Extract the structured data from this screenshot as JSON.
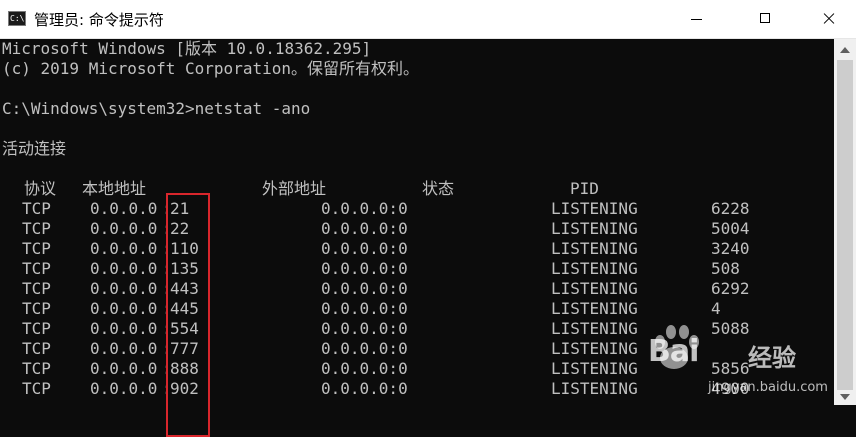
{
  "window": {
    "title": "管理员: 命令提示符",
    "icon_label": "C:\\"
  },
  "console": {
    "banner_line1": "Microsoft Windows [版本 10.0.18362.295]",
    "banner_line2": "(c) 2019 Microsoft Corporation。保留所有权利。",
    "prompt": "C:\\Windows\\system32>netstat -ano",
    "section_title": "活动连接",
    "headers": [
      "协议",
      "本地地址",
      "外部地址",
      "状态",
      "PID"
    ],
    "rows": [
      {
        "proto": "TCP",
        "local_ip": "0.0.0.0",
        "local_port": "21",
        "foreign": "0.0.0.0:0",
        "state": "LISTENING",
        "pid": "6228"
      },
      {
        "proto": "TCP",
        "local_ip": "0.0.0.0",
        "local_port": "22",
        "foreign": "0.0.0.0:0",
        "state": "LISTENING",
        "pid": "5004"
      },
      {
        "proto": "TCP",
        "local_ip": "0.0.0.0",
        "local_port": "110",
        "foreign": "0.0.0.0:0",
        "state": "LISTENING",
        "pid": "3240"
      },
      {
        "proto": "TCP",
        "local_ip": "0.0.0.0",
        "local_port": "135",
        "foreign": "0.0.0.0:0",
        "state": "LISTENING",
        "pid": "508"
      },
      {
        "proto": "TCP",
        "local_ip": "0.0.0.0",
        "local_port": "443",
        "foreign": "0.0.0.0:0",
        "state": "LISTENING",
        "pid": "6292"
      },
      {
        "proto": "TCP",
        "local_ip": "0.0.0.0",
        "local_port": "445",
        "foreign": "0.0.0.0:0",
        "state": "LISTENING",
        "pid": "4"
      },
      {
        "proto": "TCP",
        "local_ip": "0.0.0.0",
        "local_port": "554",
        "foreign": "0.0.0.0:0",
        "state": "LISTENING",
        "pid": "5088"
      },
      {
        "proto": "TCP",
        "local_ip": "0.0.0.0",
        "local_port": "777",
        "foreign": "0.0.0.0:0",
        "state": "LISTENING",
        "pid": ""
      },
      {
        "proto": "TCP",
        "local_ip": "0.0.0.0",
        "local_port": "888",
        "foreign": "0.0.0.0:0",
        "state": "LISTENING",
        "pid": "5856"
      },
      {
        "proto": "TCP",
        "local_ip": "0.0.0.0",
        "local_port": "902",
        "foreign": "0.0.0.0:0",
        "state": "LISTENING",
        "pid": "4900"
      }
    ]
  },
  "watermark": {
    "brand": "Bai",
    "brand2": "经验",
    "url": "jingyan.baidu.com"
  },
  "colors": {
    "console_bg": "#0c0c0c",
    "console_fg": "#c0c0c0",
    "highlight": "#d9262c"
  },
  "icons": {
    "app": "cmd-icon",
    "minimize": "minimize-icon",
    "maximize": "maximize-icon",
    "close": "close-icon",
    "scroll_up": "scroll-up-arrow-icon",
    "scroll_down": "scroll-down-arrow-icon"
  }
}
